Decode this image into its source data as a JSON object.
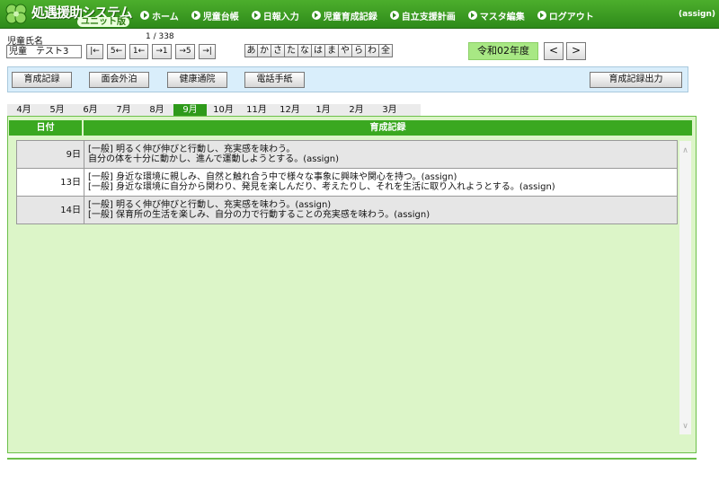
{
  "header": {
    "title": "処遇援助システム",
    "subtitle": "ユニット版",
    "user": "(assign)",
    "nav": [
      {
        "label": "ホーム"
      },
      {
        "label": "児童台帳"
      },
      {
        "label": "日報入力"
      },
      {
        "label": "児童育成記録"
      },
      {
        "label": "自立支援計画"
      },
      {
        "label": "マスタ編集"
      },
      {
        "label": "ログアウト"
      }
    ]
  },
  "child": {
    "label": "児童氏名",
    "name": "児童　テスト3",
    "record_count": "1 / 338",
    "nav_buttons": [
      "|←",
      "5←",
      "1←",
      "→1",
      "→5",
      "→|"
    ],
    "kana": [
      "あ",
      "か",
      "さ",
      "た",
      "な",
      "は",
      "ま",
      "や",
      "ら",
      "わ",
      "全"
    ]
  },
  "year": {
    "label": "令和02年度",
    "prev": "<",
    "next": ">"
  },
  "toolbar": {
    "buttons": [
      "育成記録",
      "面会外泊",
      "健康通院",
      "電話手紙"
    ],
    "output_button": "育成記録出力"
  },
  "months": [
    "4月",
    "5月",
    "6月",
    "7月",
    "8月",
    "9月",
    "10月",
    "11月",
    "12月",
    "1月",
    "2月",
    "3月"
  ],
  "active_month": "9月",
  "table": {
    "headers": {
      "date": "日付",
      "record": "育成記録"
    },
    "rows": [
      {
        "date": "9日",
        "lines": [
          "[一般] 明るく伸び伸びと行動し、充実感を味わう。",
          "自分の体を十分に動かし、進んで運動しようとする。(assign)"
        ]
      },
      {
        "date": "13日",
        "lines": [
          "[一般] 身近な環境に親しみ、自然と触れ合う中で様々な事象に興味や関心を持つ。(assign)",
          "[一般] 身近な環境に自分から関わり、発見を楽しんだり、考えたりし、それを生活に取り入れようとする。(assign)"
        ]
      },
      {
        "date": "14日",
        "lines": [
          "[一般] 明るく伸び伸びと行動し、充実感を味わう。(assign)",
          "[一般] 保育所の生活を楽しみ、自分の力で行動することの充実感を味わう。(assign)"
        ]
      }
    ]
  },
  "colors": {
    "header_green": "#2e8a1a",
    "tab_active": "#2e9a1a",
    "panel_bg": "#dcf5c8",
    "toolbar_bg": "#d9eefb",
    "year_bg": "#a8e884"
  },
  "icons": {
    "logo": "clover-icon",
    "nav": "circle-arrow-icon",
    "scroll_up": "chevron-up-icon",
    "scroll_down": "chevron-down-icon"
  }
}
